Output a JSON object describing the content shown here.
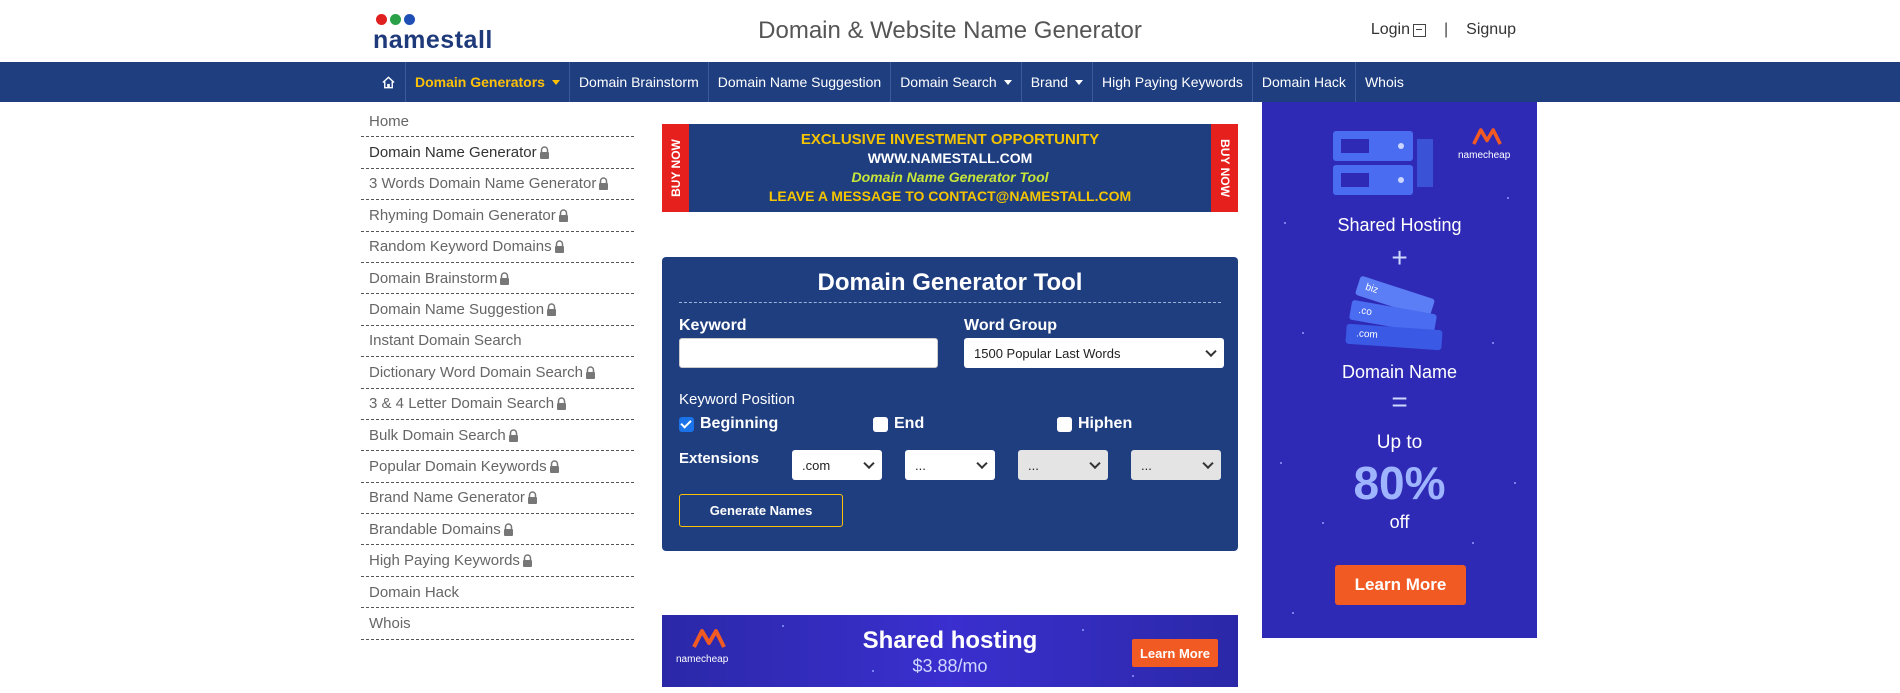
{
  "header": {
    "logo_text": "namestall",
    "logo_dot_colors": [
      "#e02020",
      "#2aa148",
      "#1f4fb5"
    ],
    "site_title": "Domain & Website Name Generator",
    "login_label": "Login",
    "separator": "|",
    "signup_label": "Signup"
  },
  "nav": {
    "home_icon": "home-icon",
    "items": [
      {
        "label": "Domain Generators",
        "dropdown": true,
        "active": true
      },
      {
        "label": "Domain Brainstorm"
      },
      {
        "label": "Domain Name Suggestion"
      },
      {
        "label": "Domain Search",
        "dropdown": true
      },
      {
        "label": "Brand",
        "dropdown": true
      },
      {
        "label": "High Paying Keywords"
      },
      {
        "label": "Domain Hack"
      },
      {
        "label": "Whois"
      }
    ]
  },
  "sidebar": {
    "items": [
      {
        "label": "Home",
        "locked": false
      },
      {
        "label": "Domain Name Generator",
        "locked": true
      },
      {
        "label": "3 Words Domain Name Generator",
        "locked": true
      },
      {
        "label": "Rhyming Domain Generator",
        "locked": true
      },
      {
        "label": "Random Keyword Domains",
        "locked": true
      },
      {
        "label": "Domain Brainstorm",
        "locked": true
      },
      {
        "label": "Domain Name Suggestion",
        "locked": true
      },
      {
        "label": "Instant Domain Search",
        "locked": false
      },
      {
        "label": "Dictionary Word Domain Search",
        "locked": true
      },
      {
        "label": "3 & 4 Letter Domain Search",
        "locked": true
      },
      {
        "label": "Bulk Domain Search",
        "locked": true
      },
      {
        "label": "Popular Domain Keywords",
        "locked": true
      },
      {
        "label": "Brand Name Generator",
        "locked": true
      },
      {
        "label": "Brandable Domains",
        "locked": true
      },
      {
        "label": "High Paying Keywords",
        "locked": true
      },
      {
        "label": "Domain Hack",
        "locked": false
      },
      {
        "label": "Whois",
        "locked": false
      }
    ]
  },
  "promo_banner": {
    "side_text": "BUY NOW",
    "line1": "EXCLUSIVE INVESTMENT OPPORTUNITY",
    "line2": "WWW.NAMESTALL.COM",
    "line3": "Domain Name Generator Tool",
    "line4": "LEAVE A MESSAGE TO CONTACT@NAMESTALL.COM"
  },
  "tool": {
    "title": "Domain Generator Tool",
    "keyword_label": "Keyword",
    "keyword_value": "",
    "word_group_label": "Word Group",
    "word_group_value": "1500 Popular Last Words",
    "position_label": "Keyword Position",
    "positions": [
      {
        "label": "Beginning",
        "checked": true
      },
      {
        "label": "End",
        "checked": false
      },
      {
        "label": "Hiphen",
        "checked": false
      }
    ],
    "extensions_label": "Extensions",
    "extensions": [
      ".com",
      "...",
      "...",
      "..."
    ],
    "generate_label": "Generate Names"
  },
  "bottom_ad": {
    "brand": "namecheap",
    "title": "Shared hosting",
    "price": "$3.88/mo",
    "cta": "Learn More"
  },
  "side_ad": {
    "brand": "namecheap",
    "line1": "Shared Hosting",
    "plus": "+",
    "tags": [
      "biz",
      ".co",
      ".com"
    ],
    "line2": "Domain Name",
    "equals": "=",
    "line3": "Up to",
    "percent": "80%",
    "line4": "off",
    "cta": "Learn More"
  },
  "colors": {
    "nav_bg": "#1e3e80",
    "nav_active": "#ffc107",
    "tool_bg": "#1e3e80",
    "ad_bg": "#2f2ab5",
    "cta_orange": "#f15a22",
    "buy_now_red": "#e5201d"
  }
}
